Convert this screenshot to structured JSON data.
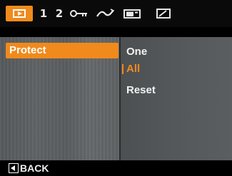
{
  "tabs": [
    {
      "id": "playback",
      "label": "",
      "icon": "playback-icon",
      "active": true
    },
    {
      "id": "1",
      "label": "1"
    },
    {
      "id": "2",
      "label": "2"
    },
    {
      "id": "key",
      "label": "",
      "icon": "key-icon"
    },
    {
      "id": "wave",
      "label": "",
      "icon": "wave-icon"
    },
    {
      "id": "camera",
      "label": "",
      "icon": "camera-icon"
    },
    {
      "id": "edit",
      "label": "",
      "icon": "edit-icon"
    }
  ],
  "menu": {
    "selected_item": "Protect"
  },
  "options": {
    "one": "One",
    "all": "All",
    "reset": "Reset",
    "highlighted": "All"
  },
  "footer": {
    "back_label": "BACK"
  },
  "colors": {
    "accent": "#f08a1c",
    "panel": "#5a5d5f",
    "background": "#000000"
  }
}
